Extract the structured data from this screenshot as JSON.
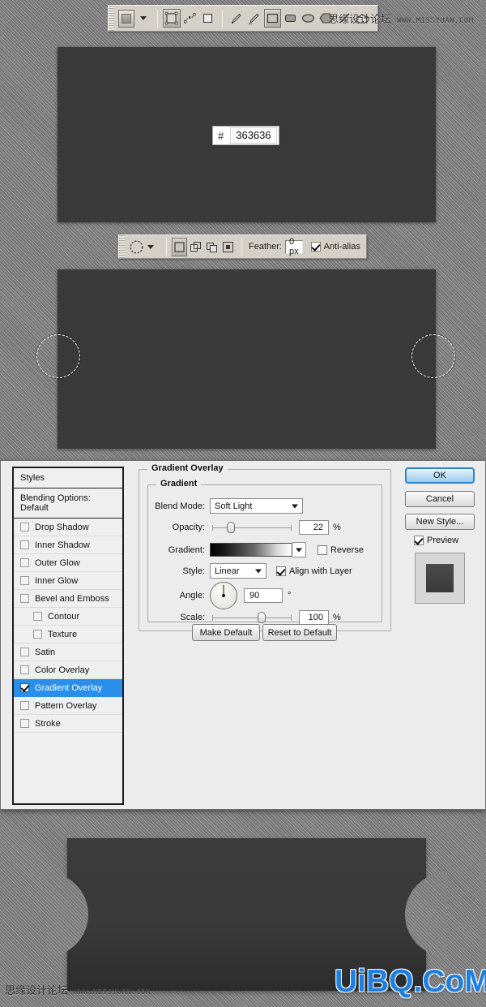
{
  "watermarks": {
    "forum_cn": "思缘设计论坛",
    "forum_url": "WWW.MISSYUAN.COM",
    "bottom_cn": "思缘设计论坛",
    "bottom_url": "WWW.MISSYUAN.COM",
    "brand": "UiBQ.CoM",
    "brand_color": "#1f7fe0"
  },
  "shape_toolbar": {
    "tool_swatch_name": "shape-tool",
    "mode_buttons": [
      "shape-layers",
      "paths",
      "fill-pixels"
    ],
    "shape_buttons": [
      "pen-tool",
      "freeform-pen-tool",
      "rectangle-tool",
      "rounded-rectangle-tool",
      "ellipse-tool",
      "polygon-tool",
      "line-tool",
      "custom-shape-tool"
    ],
    "active_mode_index": 0,
    "active_shape_index": 2
  },
  "canvas1": {
    "fill_color": "#363636",
    "hex_prefix": "#",
    "hex_value": "363636"
  },
  "marquee_toolbar": {
    "tool_name": "elliptical-marquee-tool",
    "selection_modes": [
      "new-selection",
      "add-to-selection",
      "subtract-from-selection",
      "intersect-with-selection"
    ],
    "active_selection_mode": 0,
    "feather_label": "Feather:",
    "feather_value": "0 px",
    "antialias_label": "Anti-alias",
    "antialias_checked": true
  },
  "canvas2": {
    "fill_color": "#3a3a3a",
    "selection_note": "two circular marquee selections on left and right edges"
  },
  "layer_style_dialog": {
    "styles_header": "Styles",
    "blending_options": "Blending Options: Default",
    "style_items": [
      {
        "label": "Drop Shadow",
        "checked": false,
        "indent": false
      },
      {
        "label": "Inner Shadow",
        "checked": false,
        "indent": false
      },
      {
        "label": "Outer Glow",
        "checked": false,
        "indent": false
      },
      {
        "label": "Inner Glow",
        "checked": false,
        "indent": false
      },
      {
        "label": "Bevel and Emboss",
        "checked": false,
        "indent": false
      },
      {
        "label": "Contour",
        "checked": false,
        "indent": true
      },
      {
        "label": "Texture",
        "checked": false,
        "indent": true
      },
      {
        "label": "Satin",
        "checked": false,
        "indent": false
      },
      {
        "label": "Color Overlay",
        "checked": false,
        "indent": false
      },
      {
        "label": "Gradient Overlay",
        "checked": true,
        "indent": false,
        "selected": true
      },
      {
        "label": "Pattern Overlay",
        "checked": false,
        "indent": false
      },
      {
        "label": "Stroke",
        "checked": false,
        "indent": false
      }
    ],
    "panel_title": "Gradient Overlay",
    "group_title": "Gradient",
    "fields": {
      "blend_mode_label": "Blend Mode:",
      "blend_mode_value": "Soft Light",
      "opacity_label": "Opacity:",
      "opacity_value": "22",
      "opacity_unit": "%",
      "gradient_label": "Gradient:",
      "gradient_preset": "black-to-white",
      "reverse_label": "Reverse",
      "reverse_checked": false,
      "style_label": "Style:",
      "style_value": "Linear",
      "align_label": "Align with Layer",
      "align_checked": true,
      "angle_label": "Angle:",
      "angle_value": "90",
      "angle_unit": "°",
      "scale_label": "Scale:",
      "scale_value": "100",
      "scale_unit": "%"
    },
    "make_default": "Make Default",
    "reset_default": "Reset to Default",
    "ok": "OK",
    "cancel": "Cancel",
    "new_style": "New Style...",
    "preview_label": "Preview",
    "preview_checked": true
  },
  "result": {
    "ticket_color": "#3a3a3a",
    "notch_description": "semicircular notches cut into left and right edges"
  }
}
